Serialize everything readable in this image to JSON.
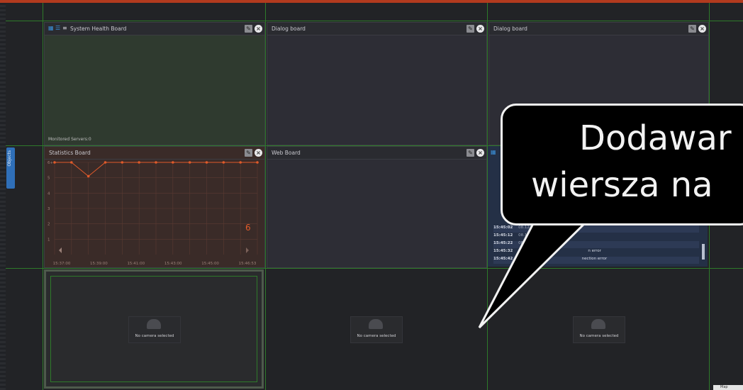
{
  "objects_tab": "Objects",
  "boards": {
    "system_health": {
      "title": "System Health Board",
      "footer": "Monitored Servers:0"
    },
    "dialog1": {
      "title": "Dialog board"
    },
    "dialog2": {
      "title": "Dialog board"
    },
    "statistics": {
      "title": "Statistics Board",
      "current_value": "6",
      "y_top_label": "6+"
    },
    "web": {
      "title": "Web Board"
    }
  },
  "chart_data": {
    "type": "line",
    "title": "Statistics Board",
    "x_ticks": [
      "15:37:00",
      "15:39:00",
      "15:41:00",
      "15:43:00",
      "15:45:00",
      "15:46:53"
    ],
    "y_ticks": [
      "1",
      "2",
      "3",
      "4",
      "5",
      "6+"
    ],
    "ylim": [
      0,
      6
    ],
    "x": [
      0,
      1,
      2,
      3,
      4,
      5,
      6,
      7,
      8,
      9,
      10,
      11,
      12
    ],
    "series": [
      {
        "values": [
          6,
          6,
          5.1,
          6,
          6,
          6,
          6,
          6,
          6,
          6,
          6,
          6,
          6
        ]
      }
    ],
    "grid": true,
    "color": "#e05a2a"
  },
  "log": {
    "rows": [
      {
        "time": "15:45:02",
        "date": "08.12.2015",
        "msg": ""
      },
      {
        "time": "15:45:12",
        "date": "08.12.2015",
        "msg": ""
      },
      {
        "time": "15:45:22",
        "date": "08.12.2015",
        "msg": ""
      },
      {
        "time": "15:45:32",
        "date": "08.12.20",
        "msg": "n error"
      },
      {
        "time": "15:45:42",
        "date": "08.12",
        "msg": "nection error"
      }
    ]
  },
  "cameras": [
    {
      "label": "No camera selected"
    },
    {
      "label": "No camera selected"
    },
    {
      "label": "No camera selected"
    }
  ],
  "callout": {
    "line1": "Dodawar",
    "line2": "wiersza na"
  },
  "map_label": "Map",
  "colors": {
    "grid_green": "#2e7a2a",
    "top_bar": "#b23a1e",
    "accent_blue": "#2f6fb8"
  }
}
